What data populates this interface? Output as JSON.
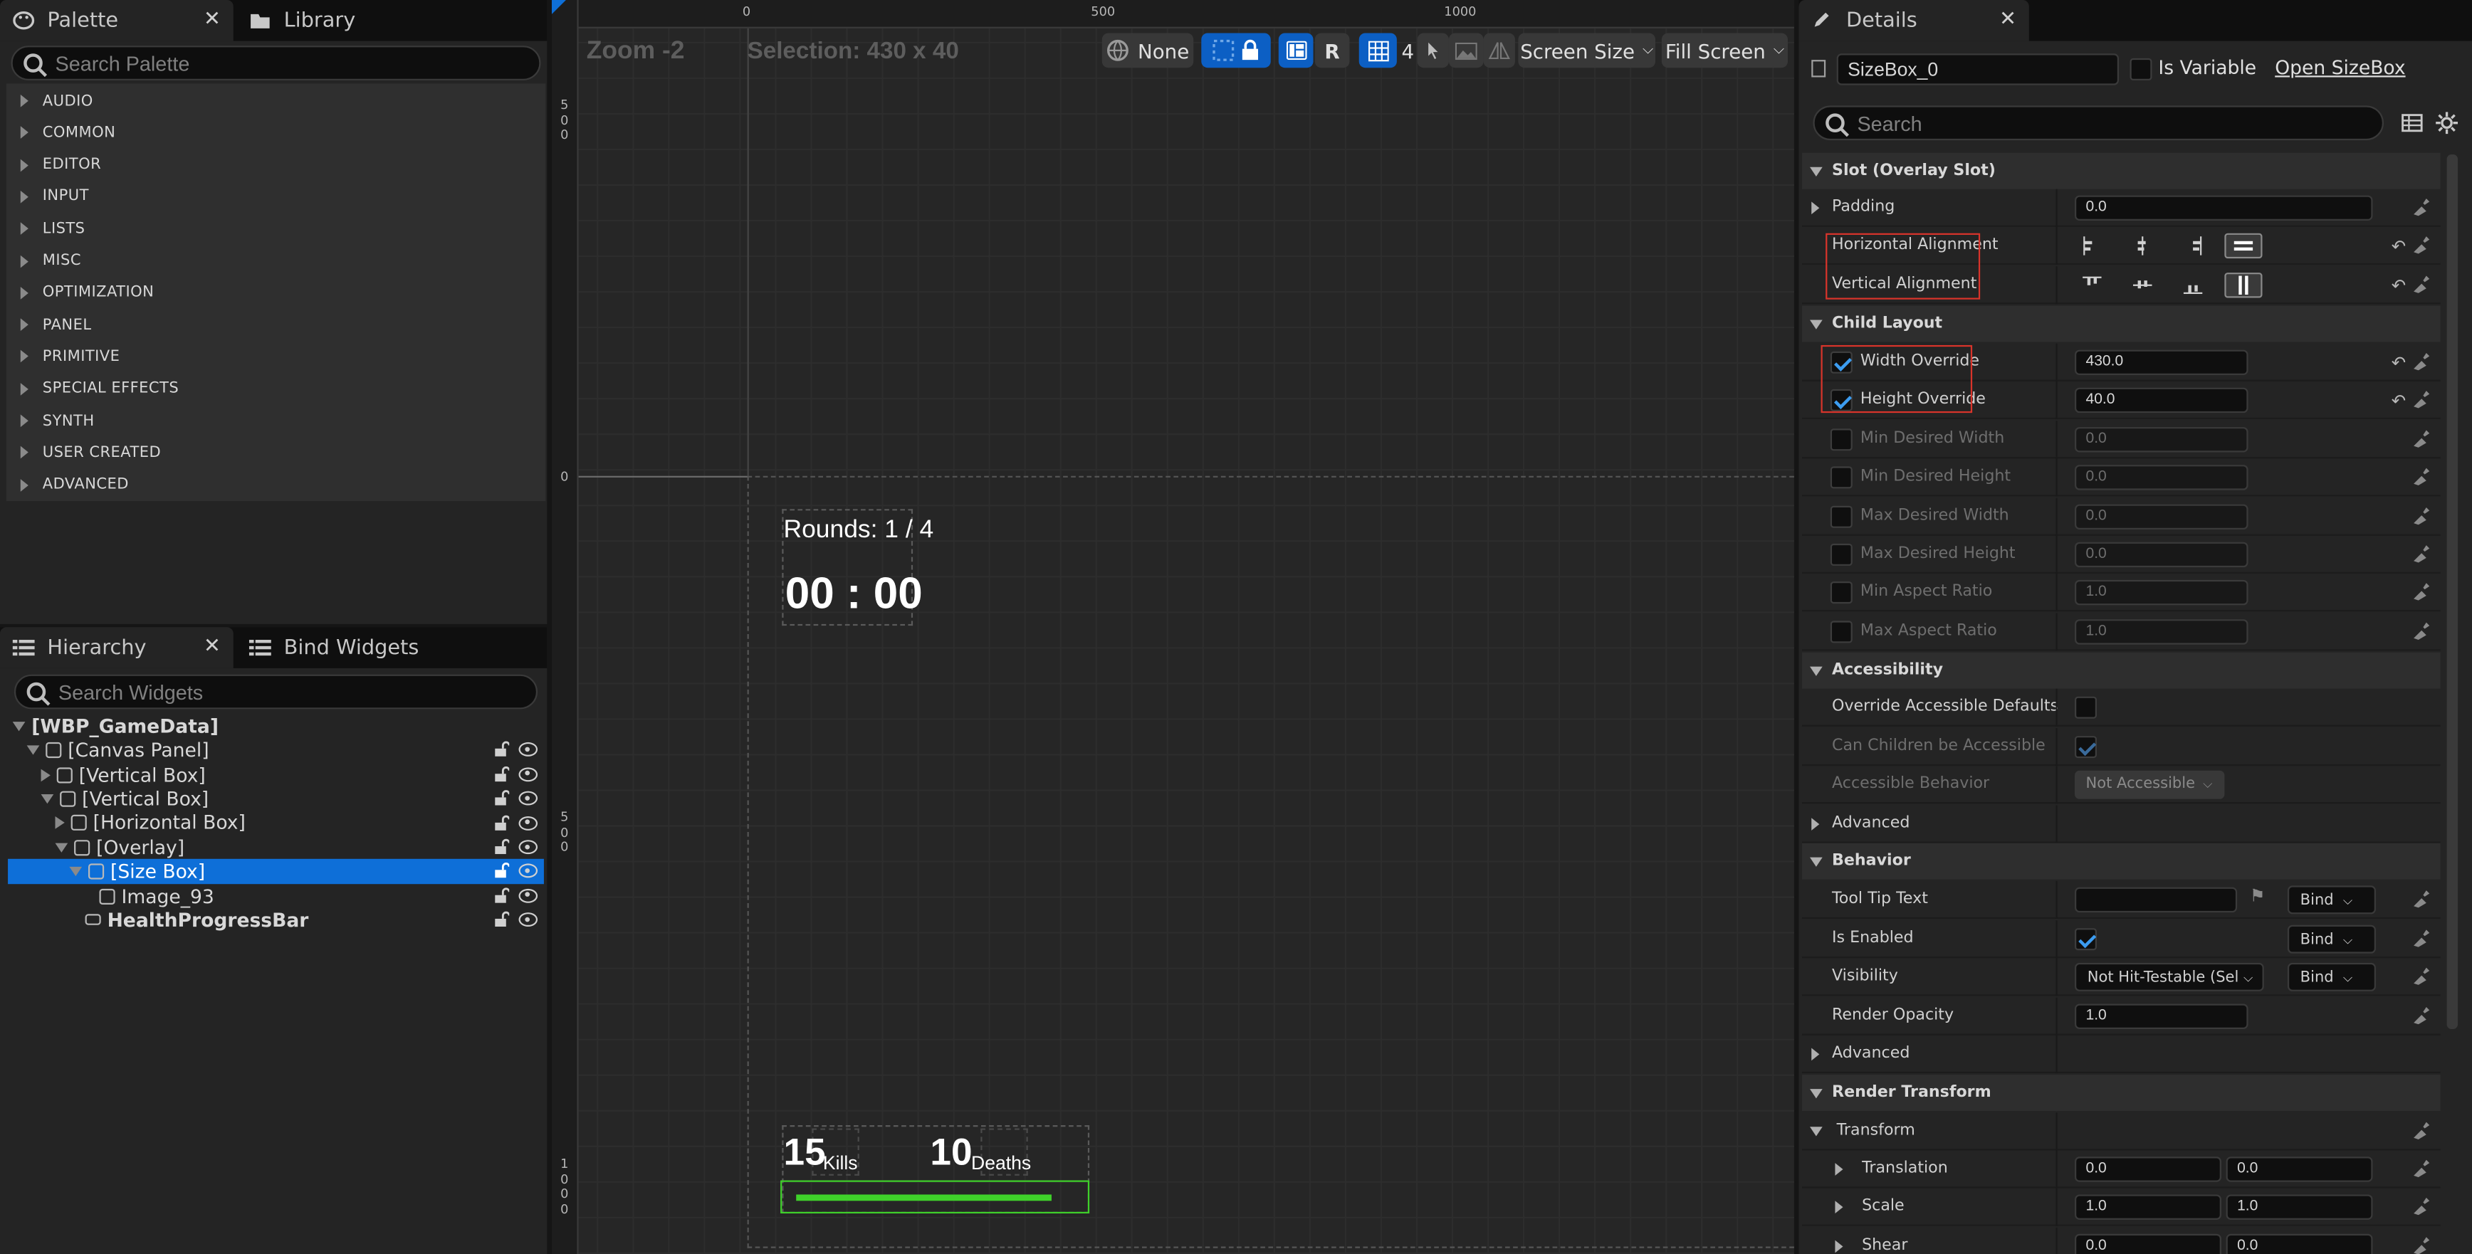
{
  "palette": {
    "tab_label": "Palette",
    "library_tab_label": "Library",
    "search_placeholder": "Search Palette",
    "categories": [
      "AUDIO",
      "COMMON",
      "EDITOR",
      "INPUT",
      "LISTS",
      "MISC",
      "OPTIMIZATION",
      "PANEL",
      "PRIMITIVE",
      "SPECIAL EFFECTS",
      "SYNTH",
      "USER CREATED",
      "ADVANCED"
    ]
  },
  "hierarchy": {
    "tab_label": "Hierarchy",
    "bind_tab_label": "Bind Widgets",
    "search_placeholder": "Search Widgets",
    "items": [
      {
        "label": "[WBP_GameData]"
      },
      {
        "label": "[Canvas Panel]"
      },
      {
        "label": "[Vertical Box]"
      },
      {
        "label": "[Vertical Box]"
      },
      {
        "label": "[Horizontal Box]"
      },
      {
        "label": "[Overlay]"
      },
      {
        "label": "[Size Box]"
      },
      {
        "label": "Image_93"
      },
      {
        "label": "HealthProgressBar"
      }
    ]
  },
  "viewport": {
    "zoom": "Zoom -2",
    "selection": "Selection: 430 x 40",
    "ruler_top": [
      "0",
      "500",
      "1000"
    ],
    "ruler_left": [
      "500",
      "0",
      "500",
      "1000"
    ],
    "toolbar": {
      "locale": "None",
      "r_label": "R",
      "grid_value": "4",
      "screen_size": "Screen Size",
      "fill_screen": "Fill Screen"
    },
    "hud": {
      "rounds": "Rounds: 1 / 4",
      "timer": "00 : 00",
      "kills_value": "15",
      "kills_label": "Kills",
      "deaths_value": "10",
      "deaths_label": "Deaths",
      "health_fraction": 0.92,
      "health_color": "#3fd12a"
    }
  },
  "details": {
    "tab_label": "Details",
    "widget_name": "SizeBox_0",
    "is_variable_label": "Is Variable",
    "open_link": "Open SizeBox",
    "search_placeholder": "Search",
    "sections": {
      "slot": "Slot (Overlay Slot)",
      "child_layout": "Child Layout",
      "accessibility": "Accessibility",
      "behavior": "Behavior",
      "render_transform": "Render Transform"
    },
    "padding": {
      "label": "Padding",
      "value": "0.0"
    },
    "h_align_label": "Horizontal Alignment",
    "v_align_label": "Vertical Alignment",
    "width_override": {
      "label": "Width Override",
      "value": "430.0"
    },
    "height_override": {
      "label": "Height Override",
      "value": "40.0"
    },
    "min_desired_width": {
      "label": "Min Desired Width",
      "value": "0.0"
    },
    "min_desired_height": {
      "label": "Min Desired Height",
      "value": "0.0"
    },
    "max_desired_width": {
      "label": "Max Desired Width",
      "value": "0.0"
    },
    "max_desired_height": {
      "label": "Max Desired Height",
      "value": "0.0"
    },
    "min_aspect_ratio": {
      "label": "Min Aspect Ratio",
      "value": "1.0"
    },
    "max_aspect_ratio": {
      "label": "Max Aspect Ratio",
      "value": "1.0"
    },
    "override_accessible_defaults": "Override Accessible Defaults",
    "can_children_be_accessible": "Can Children be Accessible",
    "accessible_behavior": {
      "label": "Accessible Behavior",
      "value": "Not Accessible"
    },
    "advanced_label": "Advanced",
    "tool_tip_text": "Tool Tip Text",
    "bind_label": "Bind",
    "is_enabled": "Is Enabled",
    "visibility": {
      "label": "Visibility",
      "value": "Not Hit-Testable (Self Only)"
    },
    "render_opacity": {
      "label": "Render Opacity",
      "value": "1.0"
    },
    "transform_label": "Transform",
    "translation": {
      "label": "Translation",
      "x": "0.0",
      "y": "0.0"
    },
    "scale": {
      "label": "Scale",
      "x": "1.0",
      "y": "1.0"
    },
    "shear": {
      "label": "Shear",
      "x": "0.0",
      "y": "0.0"
    }
  }
}
